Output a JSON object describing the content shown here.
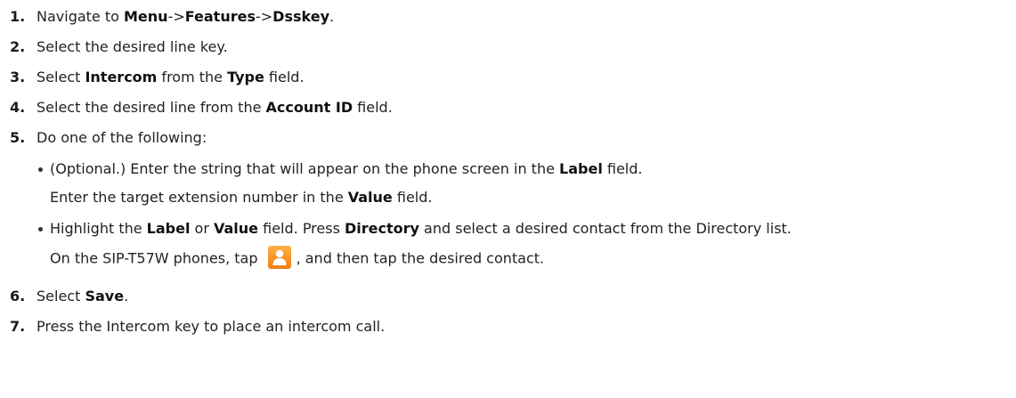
{
  "steps": [
    {
      "num": "1.",
      "pre": "Navigate to ",
      "b1": "Menu",
      "s1": "->",
      "b2": "Features",
      "s2": "->",
      "b3": "Dsskey",
      "post": "."
    },
    {
      "num": "2.",
      "text": "Select the desired line key."
    },
    {
      "num": "3.",
      "pre": "Select ",
      "b1": "Intercom",
      "mid": " from the ",
      "b2": "Type",
      "post": " field."
    },
    {
      "num": "4.",
      "pre": "Select the desired line from the ",
      "b1": "Account ID",
      "post": " field."
    },
    {
      "num": "5.",
      "text": "Do one of the following:"
    },
    {
      "num": "6.",
      "pre": "Select ",
      "b1": "Save",
      "post": "."
    },
    {
      "num": "7.",
      "text": "Press the Intercom key to place an intercom call."
    }
  ],
  "bullets": [
    {
      "pre": "(Optional.) Enter the string that will appear on the phone screen in the ",
      "b1": "Label",
      "post": " field.",
      "line2_pre": " Enter the target extension number in the ",
      "line2_b": "Value",
      "line2_post": " field."
    },
    {
      "pre": "Highlight the ",
      "b1": "Label",
      "mid1": " or ",
      "b2": "Value",
      "mid2": " field. Press ",
      "b3": "Directory",
      "post": " and select a desired contact from the Directory list.",
      "line2_pre": "On the SIP-T57W phones, tap ",
      "line2_post": ", and then tap the desired contact.",
      "icon": "directory-contact-icon"
    }
  ],
  "colors": {
    "text": "#222222",
    "icon_gradient_top": "#ffb247",
    "icon_gradient_bottom": "#f07d14"
  }
}
